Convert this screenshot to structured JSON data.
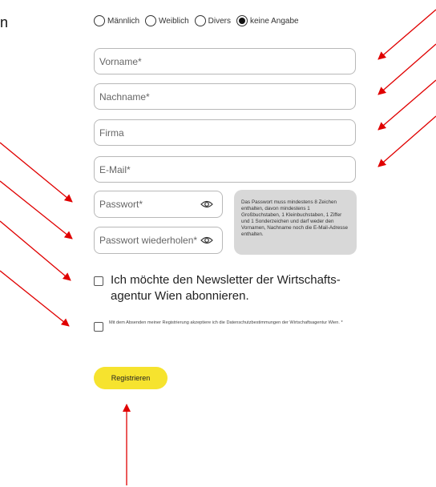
{
  "corner_glyph": "n",
  "gender": {
    "options": [
      {
        "label": "Männlich",
        "checked": false
      },
      {
        "label": "Weiblich",
        "checked": false
      },
      {
        "label": "Divers",
        "checked": false
      },
      {
        "label": "keine Angabe",
        "checked": true
      }
    ]
  },
  "fields": {
    "vorname": "Vorname*",
    "nachname": "Nachname*",
    "firma": "Firma",
    "email": "E-Mail*",
    "passwort": "Passwort*",
    "passwort_wiederholen": "Passwort wiederholen*"
  },
  "password_hint": "Das Passwort muss mindestens 8 Zeichen enthalten, davon mindestens 1 Großbuchstaben, 1 Kleinbuchstaben, 1 Ziffer und 1 Sonderzeichen und darf weder den Vornamen, Nachname noch die E-Mail-Adresse enthalten.",
  "newsletter_label": "Ich möchte den Newsletter der Wirtschafts-agentur Wien abonnieren.",
  "privacy_label": "Mit dem Absenden meiner Registrierung akzeptiere ich die Datenschutzbestimmungen der Wirtschaftsagentur Wien. *",
  "register_button": "Registrieren",
  "colors": {
    "accent": "#f6e32e",
    "arrow": "#e00000",
    "hint_bg": "#d8d8d8"
  },
  "icons": [
    "eye-icon",
    "arrow-icon"
  ]
}
